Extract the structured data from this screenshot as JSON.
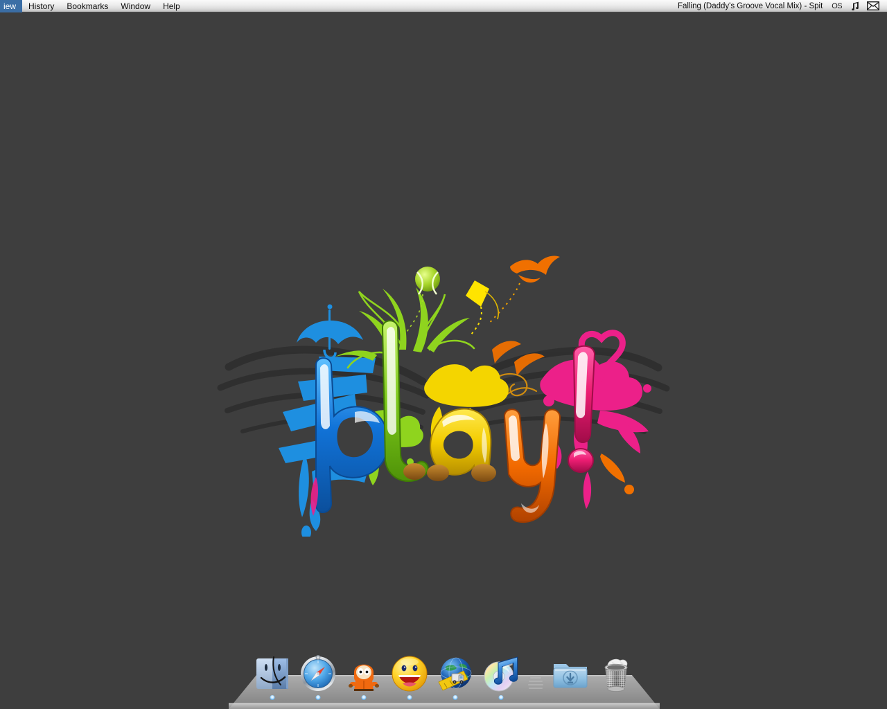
{
  "menubar": {
    "items": [
      {
        "label": "iew",
        "name": "menu-view"
      },
      {
        "label": "History",
        "name": "menu-history"
      },
      {
        "label": "Bookmarks",
        "name": "menu-bookmarks"
      },
      {
        "label": "Window",
        "name": "menu-window"
      },
      {
        "label": "Help",
        "name": "menu-help"
      }
    ],
    "now_playing": "Falling (Daddy's Groove Vocal Mix) - Spit",
    "extras": [
      {
        "label": "OS",
        "name": "os-menu-extra-icon"
      },
      {
        "label": "♫",
        "name": "music-note-icon"
      },
      {
        "label": "",
        "name": "mail-envelope-icon"
      }
    ]
  },
  "desktop": {
    "background_color": "#3e3e3e",
    "wallpaper_title": "play!",
    "wallpaper_colors": {
      "blue": "#1e8fe0",
      "green": "#8fd41e",
      "yellow": "#f4d500",
      "orange": "#f07000",
      "magenta": "#ec2089",
      "dark": "#333333"
    },
    "wallpaper_elements": [
      "umbrella",
      "tennis-ball",
      "grass-swirls",
      "kite",
      "bird",
      "heart",
      "paint-splashes",
      "wings",
      "letter-p",
      "letter-l",
      "letter-a",
      "letter-y",
      "exclamation-mark"
    ]
  },
  "dock": {
    "items": [
      {
        "name": "finder",
        "label": "Finder",
        "running": true
      },
      {
        "name": "safari",
        "label": "Safari",
        "running": true
      },
      {
        "name": "aim",
        "label": "AIM",
        "running": true
      },
      {
        "name": "yahoo",
        "label": "Yahoo! Messenger",
        "running": true
      },
      {
        "name": "transmit",
        "label": "Transmit",
        "running": true
      },
      {
        "name": "itunes",
        "label": "iTunes",
        "running": true
      },
      {
        "name": "separator",
        "label": "",
        "running": false
      },
      {
        "name": "downloads",
        "label": "Downloads",
        "running": false
      },
      {
        "name": "trash",
        "label": "Trash",
        "running": false
      }
    ]
  }
}
